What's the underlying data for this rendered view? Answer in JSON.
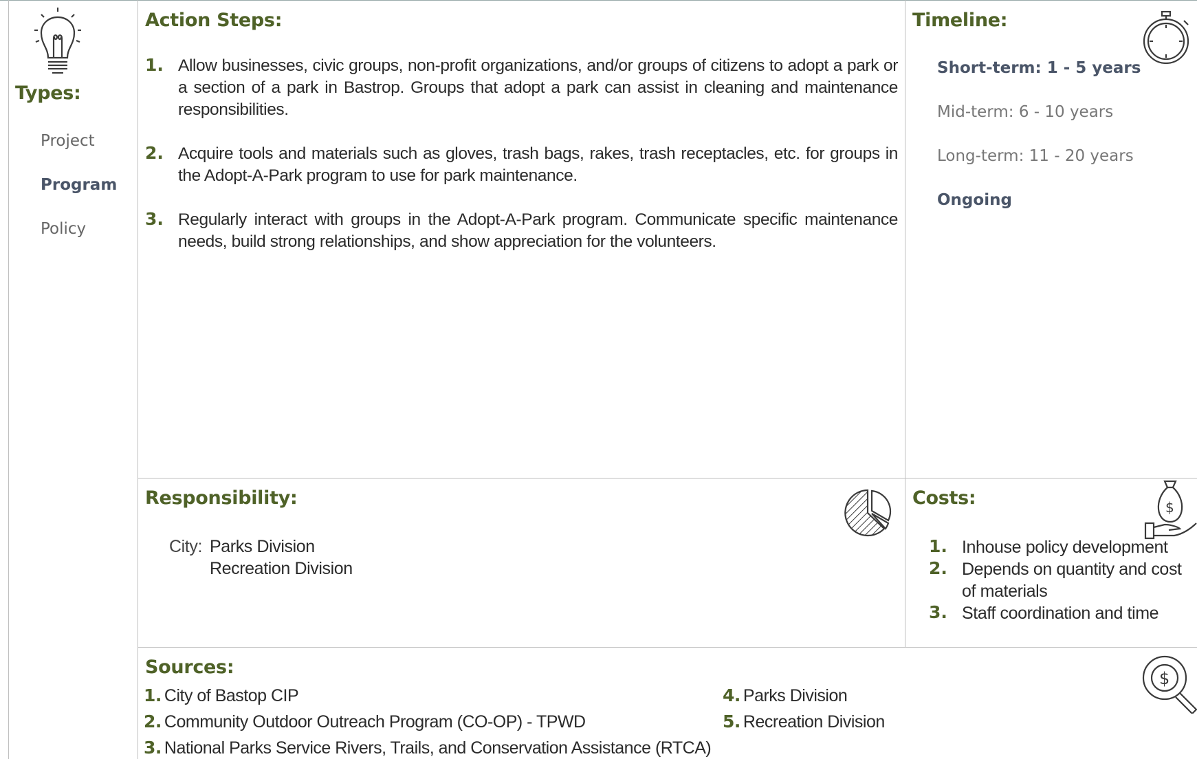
{
  "types": {
    "heading": "Types:",
    "items": [
      {
        "label": "Project",
        "selected": false
      },
      {
        "label": "Program",
        "selected": true
      },
      {
        "label": "Policy",
        "selected": false
      }
    ]
  },
  "action_steps": {
    "heading": "Action Steps:",
    "items": [
      {
        "num": "1.",
        "text": "Allow businesses, civic groups, non-profit organizations, and/or groups of citizens to adopt a park or a section of a park in Bastrop. Groups that adopt a park can assist in cleaning and maintenance responsibilities."
      },
      {
        "num": "2.",
        "text": "Acquire tools and materials such as gloves, trash bags, rakes, trash receptacles, etc. for groups in the Adopt-A-Park program to use for park maintenance."
      },
      {
        "num": "3.",
        "text": "Regularly interact with groups in the Adopt-A-Park program. Communicate specific maintenance needs, build strong relationships, and show appreciation for the volunteers."
      }
    ]
  },
  "timeline": {
    "heading": "Timeline:",
    "short": "Short-term:  1 - 5 years",
    "mid": "Mid-term:  6 - 10 years",
    "long": "Long-term:  11 - 20 years",
    "ongoing": "Ongoing"
  },
  "responsibility": {
    "heading": "Responsibility:",
    "label": "City:",
    "lines": [
      "Parks Division",
      "Recreation Division"
    ]
  },
  "costs": {
    "heading": "Costs:",
    "items": [
      {
        "num": "1.",
        "text": "Inhouse policy development"
      },
      {
        "num": "2.",
        "text": "Depends on quantity and cost of materials"
      },
      {
        "num": "3.",
        "text": "Staff coordination and time"
      }
    ]
  },
  "sources": {
    "heading": "Sources:",
    "items": [
      {
        "num": "1.",
        "text": "City of Bastop CIP"
      },
      {
        "num": "2.",
        "text": "Community Outdoor Outreach Program (CO-OP) - TPWD"
      },
      {
        "num": "3.",
        "text": "National Parks Service Rivers, Trails, and Conservation Assistance (RTCA)"
      },
      {
        "num": "4.",
        "text": "Parks Division"
      },
      {
        "num": "5.",
        "text": "Recreation Division"
      }
    ]
  },
  "icons": {
    "types": "lightbulb-icon",
    "timeline": "stopwatch-icon",
    "responsibility": "pie-chart-icon",
    "costs": "money-bag-hand-icon",
    "sources": "magnifier-dollar-icon"
  },
  "colors": {
    "heading": "#4f6228",
    "bold_label": "#4a5568",
    "muted": "#777777",
    "rule": "#bfbfbf"
  }
}
